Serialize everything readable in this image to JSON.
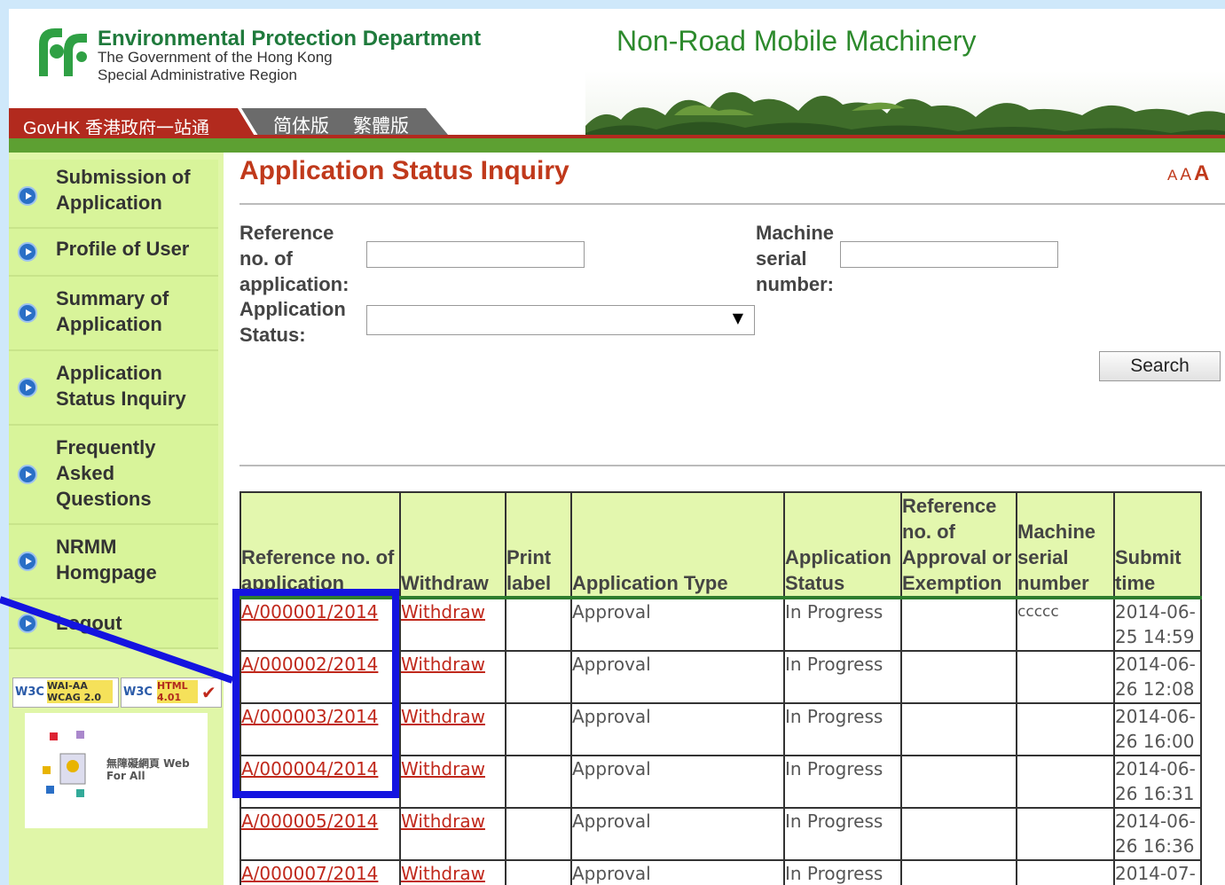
{
  "header": {
    "department": "Environmental Protection Department",
    "gov_line1": "The Government of the Hong Kong",
    "gov_line2": "Special Administrative Region",
    "site_title": "Non-Road Mobile Machinery",
    "govhk": "GovHK 香港政府一站通",
    "simplified": "简体版",
    "traditional": "繁體版"
  },
  "sidebar": {
    "items": [
      {
        "label": "Submission of Application"
      },
      {
        "label": "Profile of User"
      },
      {
        "label": "Summary of Application"
      },
      {
        "label": "Application Status Inquiry"
      },
      {
        "label": "Frequently Asked Questions"
      },
      {
        "label": "NRMM Homgpage"
      },
      {
        "label": "Logout"
      }
    ],
    "badge_w3c_wai": "WAI-AA WCAG 2.0",
    "badge_w3c_html": "HTML 4.01",
    "webforall": "無障礙網頁 Web For All"
  },
  "main": {
    "title": "Application Status Inquiry",
    "font_sizer": [
      "A",
      "A",
      "A"
    ],
    "form": {
      "ref_label": "Reference no. of application:",
      "serial_label": "Machine serial number:",
      "status_label": "Application Status:",
      "ref_value": "",
      "serial_value": "",
      "status_value": "",
      "search_label": "Search"
    },
    "table": {
      "headers": [
        "Reference no. of application",
        "Withdraw",
        "Print label",
        "Application Type",
        "Application Status",
        "Reference no. of Approval or Exemption",
        "Machine serial number",
        "Submit time"
      ],
      "rows": [
        {
          "ref": "A/000001/2014",
          "withdraw": "Withdraw",
          "print": "",
          "type": "Approval",
          "status": "In Progress",
          "approval": "",
          "serial": "ccccc",
          "time": "2014-06-25 14:59"
        },
        {
          "ref": "A/000002/2014",
          "withdraw": "Withdraw",
          "print": "",
          "type": "Approval",
          "status": "In Progress",
          "approval": "",
          "serial": "",
          "time": "2014-06-26 12:08"
        },
        {
          "ref": "A/000003/2014",
          "withdraw": "Withdraw",
          "print": "",
          "type": "Approval",
          "status": "In Progress",
          "approval": "",
          "serial": "",
          "time": "2014-06-26 16:00"
        },
        {
          "ref": "A/000004/2014",
          "withdraw": "Withdraw",
          "print": "",
          "type": "Approval",
          "status": "In Progress",
          "approval": "",
          "serial": "",
          "time": "2014-06-26 16:31"
        },
        {
          "ref": "A/000005/2014",
          "withdraw": "Withdraw",
          "print": "",
          "type": "Approval",
          "status": "In Progress",
          "approval": "",
          "serial": "",
          "time": "2014-06-26 16:36"
        },
        {
          "ref": "A/000007/2014",
          "withdraw": "Withdraw",
          "print": "",
          "type": "Approval",
          "status": "In Progress",
          "approval": "",
          "serial": "",
          "time": "2014-07-"
        }
      ]
    }
  },
  "colors": {
    "accent_red": "#c0391b",
    "brand_green": "#5da032",
    "sidebar_bg": "#d8f49a",
    "annotation_blue": "#1414e0"
  }
}
